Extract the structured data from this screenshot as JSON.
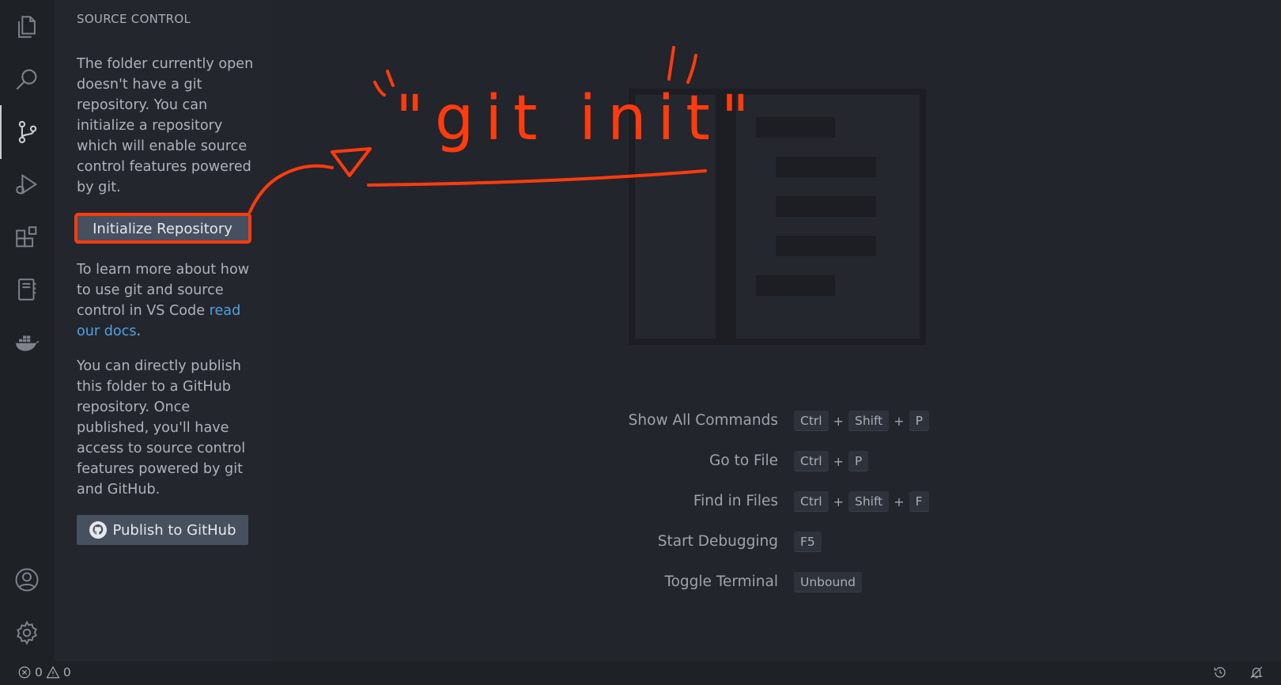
{
  "sidebar": {
    "title": "SOURCE CONTROL",
    "message1": "The folder currently open doesn't have a git repository. You can initialize a repository which will enable source control features powered by git.",
    "init_button": "Initialize Repository",
    "message2_pre": "To learn more about how to use git and source control in VS Code ",
    "message2_link": "read our docs",
    "message2_post": ".",
    "message3": "You can directly publish this folder to a GitHub repository. Once published, you'll have access to source control features powered by git and GitHub.",
    "publish_button": "Publish to GitHub"
  },
  "activity_bar": {
    "icons": [
      "files-icon",
      "search-icon",
      "source-control-icon",
      "run-debug-icon",
      "extensions-icon",
      "notebook-icon",
      "docker-icon",
      "account-icon",
      "gear-icon"
    ],
    "active": "source-control-icon"
  },
  "shortcuts": [
    {
      "label": "Show All Commands",
      "keys": [
        "Ctrl",
        "Shift",
        "P"
      ]
    },
    {
      "label": "Go to File",
      "keys": [
        "Ctrl",
        "P"
      ]
    },
    {
      "label": "Find in Files",
      "keys": [
        "Ctrl",
        "Shift",
        "F"
      ]
    },
    {
      "label": "Start Debugging",
      "keys": [
        "F5"
      ]
    },
    {
      "label": "Toggle Terminal",
      "keys": [
        "Unbound"
      ]
    }
  ],
  "statusbar": {
    "errors": "0",
    "warnings": "0"
  },
  "annotation": {
    "text": "\"git init\"",
    "color": "#ff3b0f"
  },
  "colors": {
    "accent_link": "#4ea1e0",
    "button_bg": "#47505e"
  }
}
